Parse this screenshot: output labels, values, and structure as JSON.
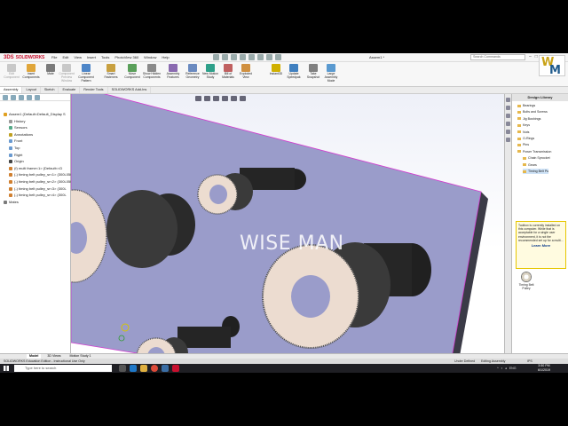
{
  "app": {
    "logo_text": "SOLIDWORKS",
    "menus": [
      "File",
      "Edit",
      "View",
      "Insert",
      "Tools",
      "PhotoView 360",
      "Window",
      "Help"
    ],
    "document_title": "Assem1 *",
    "search_placeholder": "Search Commands",
    "brand_logo": "WM"
  },
  "ribbon": {
    "buttons": [
      {
        "label": "Edit Component",
        "icon": "edit-component-icon",
        "disabled": true
      },
      {
        "label": "Insert Components",
        "icon": "insert-components-icon",
        "disabled": false
      },
      {
        "label": "Mate",
        "icon": "mate-icon",
        "disabled": false
      },
      {
        "label": "Component Preview Window",
        "icon": "component-preview-icon",
        "disabled": true
      },
      {
        "label": "Linear Component Pattern",
        "icon": "linear-pattern-icon",
        "disabled": false
      },
      {
        "label": "Smart Fasteners",
        "icon": "smart-fasteners-icon",
        "disabled": false
      },
      {
        "label": "Move Component",
        "icon": "move-component-icon",
        "disabled": false
      },
      {
        "label": "Show Hidden Components",
        "icon": "show-hidden-icon",
        "disabled": false
      },
      {
        "label": "Assembly Features",
        "icon": "assembly-features-icon",
        "disabled": false
      },
      {
        "label": "Reference Geometry",
        "icon": "reference-geometry-icon",
        "disabled": false
      },
      {
        "label": "New Motion Study",
        "icon": "motion-study-icon",
        "disabled": false
      },
      {
        "label": "Bill of Materials",
        "icon": "bill-of-materials-icon",
        "disabled": false
      },
      {
        "label": "Exploded View",
        "icon": "exploded-view-icon",
        "disabled": false
      },
      {
        "label": "Instant3D",
        "icon": "instant3d-icon",
        "disabled": false
      },
      {
        "label": "Update Speedpak",
        "icon": "speedpak-icon",
        "disabled": false
      },
      {
        "label": "Take Snapshot",
        "icon": "snapshot-icon",
        "disabled": false
      },
      {
        "label": "Large Assembly Mode",
        "icon": "large-assembly-icon",
        "disabled": false
      }
    ]
  },
  "tabs": [
    "Assembly",
    "Layout",
    "Sketch",
    "Evaluate",
    "Render Tools",
    "SOLIDWORKS Add-Ins"
  ],
  "tree": {
    "filter_icon": "filter-icon",
    "nodes": [
      "Assem1  (Default<Default_Display S",
      "History",
      "Sensors",
      "Annotations",
      "Front",
      "Top",
      "Right",
      "Origin",
      "(f) multi frame<1> (Default<<D",
      "(-) timing belt pulley_sr<1> (300L050",
      "(-) timing belt pulley_sr<2> (300L050",
      "(-) timing belt pulley_sr<3> (300L",
      "(-) timing belt pulley_sr<4> (300L",
      "Mates"
    ]
  },
  "viewport": {
    "watermark": "WISE MAN"
  },
  "design_library": {
    "title": "Design Library",
    "items": [
      "Bearings",
      "Bolts and Screws",
      "Jig Bushings",
      "Keys",
      "Nuts",
      "O-Rings",
      "Pins",
      "Power Transmission",
      "Chain Sprocket",
      "Gears",
      "Timing Belt Pu"
    ],
    "toolbox_note": "Toolbox is currently installed on this computer. While that is acceptable for a single user environment, it is not the recommended set up for a multi...",
    "learn_more": "Learn More",
    "thumbnail_label": "Timing Belt Pulley"
  },
  "bottom_tabs": [
    "Model",
    "3D Views",
    "Motion Study 1"
  ],
  "status": {
    "left": "SOLIDWORKS Education Edition - Instructional Use Only",
    "under_defined": "Under Defined",
    "editing": "Editing Assembly",
    "units": "IPS"
  },
  "taskbar": {
    "search_placeholder": "Type here to search",
    "tray_lang": "ENG",
    "time": "3:50 PM",
    "date": "6/1/2019"
  },
  "colors": {
    "plate_face": "#9a9cca",
    "plate_edge": "#3b3b47",
    "pulley_face": "#ecdcd0",
    "shaft": "#222222",
    "selection_edge": "#d33ccf"
  }
}
